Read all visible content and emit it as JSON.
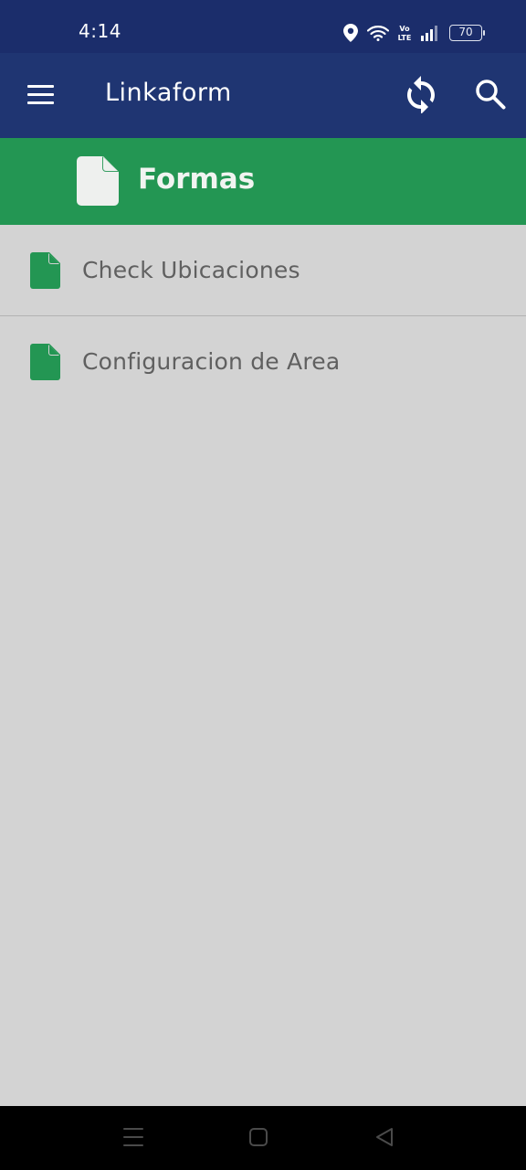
{
  "status_bar": {
    "time": "4:14",
    "volte_label": "Vo LTE",
    "battery_level": "70"
  },
  "app_bar": {
    "title": "Linkaform",
    "menu_icon": "hamburger-menu-icon",
    "sync_icon": "sync-icon",
    "search_icon": "search-icon",
    "background_color": "#1f3572"
  },
  "section": {
    "title": "Formas",
    "icon": "document-icon",
    "background_color": "#239653"
  },
  "forms": [
    {
      "label": "Check Ubicaciones",
      "icon": "document-icon"
    },
    {
      "label": "Configuracion de Area",
      "icon": "document-icon"
    }
  ],
  "nav_bar": {
    "recents_icon": "recents-icon",
    "home_icon": "home-icon",
    "back_icon": "back-icon"
  }
}
